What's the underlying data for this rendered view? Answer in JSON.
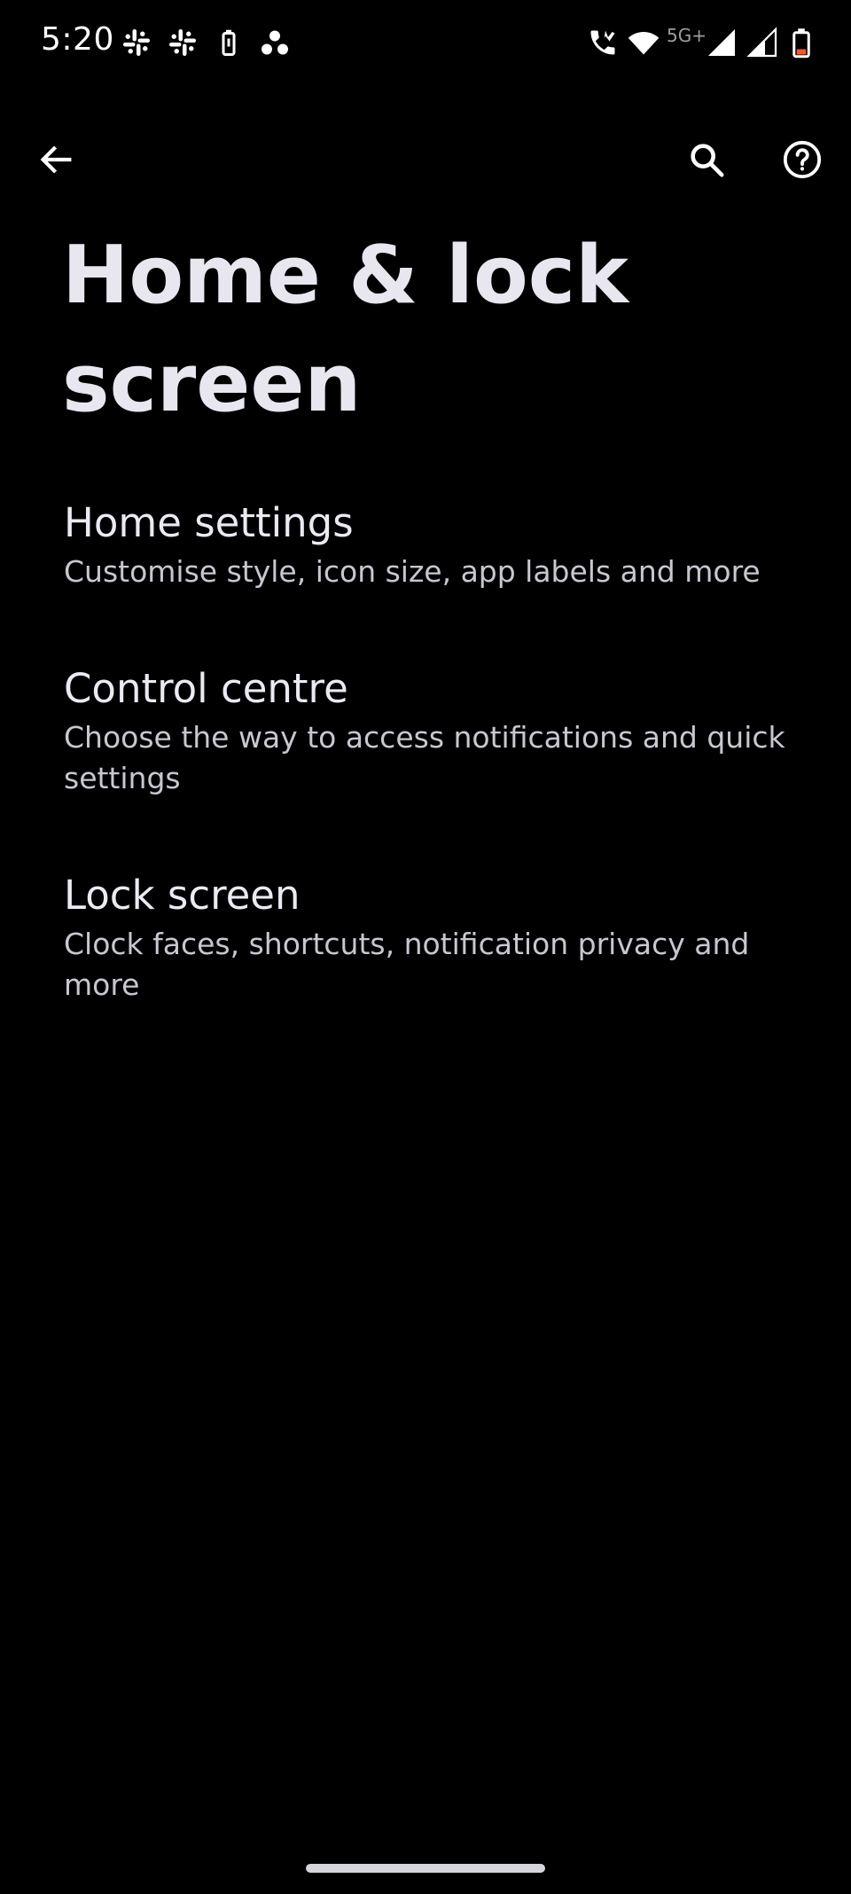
{
  "status_bar": {
    "time": "5:20",
    "network_label": "5G+",
    "notification_icons": [
      "slack-icon",
      "slack-icon",
      "battery-saver-icon",
      "dots-app-icon"
    ],
    "system_icons": [
      "wifi-calling-icon",
      "wifi-icon",
      "signal-full-icon",
      "signal-partial-icon",
      "battery-low-icon"
    ],
    "battery_accent": "#ff5722"
  },
  "app_bar": {
    "back_icon": "arrow-back-icon",
    "search_icon": "search-icon",
    "help_icon": "help-circle-icon"
  },
  "page": {
    "title": "Home & lock screen"
  },
  "settings": {
    "items": [
      {
        "title": "Home settings",
        "summary": "Customise style, icon size, app labels and more"
      },
      {
        "title": "Control centre",
        "summary": "Choose the way to access notifications and quick settings"
      },
      {
        "title": "Lock screen",
        "summary": "Clock faces, shortcuts, notification privacy and more"
      }
    ]
  },
  "colors": {
    "background": "#000000",
    "title_text": "#e8e6ee",
    "summary_text": "#c8c6cf",
    "icon": "#ffffff"
  }
}
